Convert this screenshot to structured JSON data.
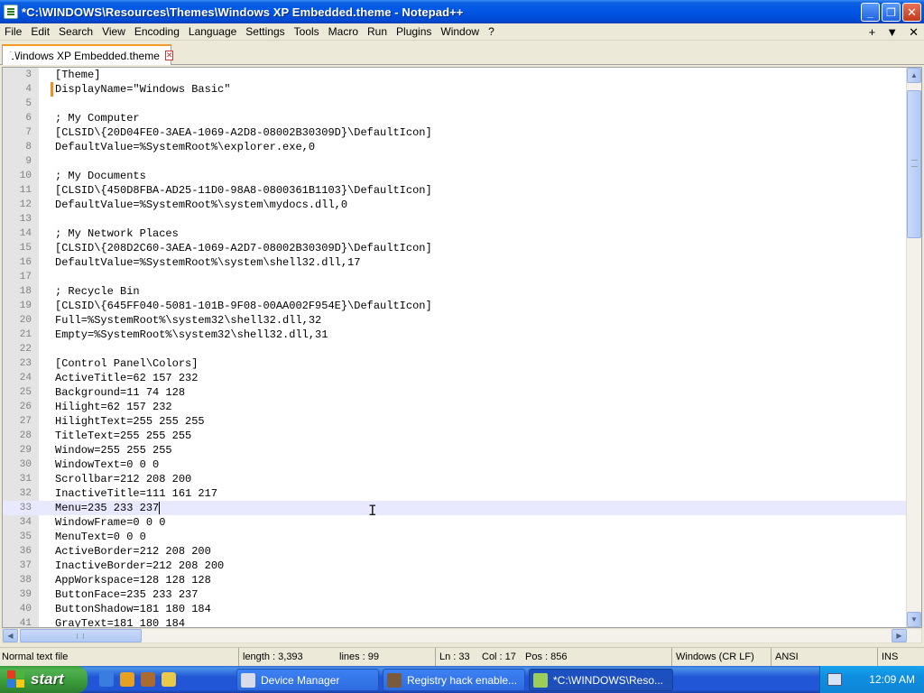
{
  "window": {
    "title": "*C:\\WINDOWS\\Resources\\Themes\\Windows XP Embedded.theme - Notepad++",
    "minimize_glyph": "_",
    "maximize_glyph": "❐",
    "close_glyph": "✕"
  },
  "menu": {
    "items": [
      "File",
      "Edit",
      "Search",
      "View",
      "Encoding",
      "Language",
      "Settings",
      "Tools",
      "Macro",
      "Run",
      "Plugins",
      "Window",
      "?"
    ],
    "right_glyphs": [
      "+",
      "▼",
      "✕"
    ]
  },
  "tab": {
    "label": "Windows XP Embedded.theme",
    "close_glyph": "✕"
  },
  "editor": {
    "current_line": 33,
    "lines": [
      {
        "n": "3",
        "t": "[Theme]"
      },
      {
        "n": "4",
        "t": "DisplayName=\"Windows Basic\""
      },
      {
        "n": "5",
        "t": ""
      },
      {
        "n": "6",
        "t": "; My Computer"
      },
      {
        "n": "7",
        "t": "[CLSID\\{20D04FE0-3AEA-1069-A2D8-08002B30309D}\\DefaultIcon]"
      },
      {
        "n": "8",
        "t": "DefaultValue=%SystemRoot%\\explorer.exe,0"
      },
      {
        "n": "9",
        "t": ""
      },
      {
        "n": "10",
        "t": "; My Documents"
      },
      {
        "n": "11",
        "t": "[CLSID\\{450D8FBA-AD25-11D0-98A8-0800361B1103}\\DefaultIcon]"
      },
      {
        "n": "12",
        "t": "DefaultValue=%SystemRoot%\\system\\mydocs.dll,0"
      },
      {
        "n": "13",
        "t": ""
      },
      {
        "n": "14",
        "t": "; My Network Places"
      },
      {
        "n": "15",
        "t": "[CLSID\\{208D2C60-3AEA-1069-A2D7-08002B30309D}\\DefaultIcon]"
      },
      {
        "n": "16",
        "t": "DefaultValue=%SystemRoot%\\system\\shell32.dll,17"
      },
      {
        "n": "17",
        "t": ""
      },
      {
        "n": "18",
        "t": "; Recycle Bin"
      },
      {
        "n": "19",
        "t": "[CLSID\\{645FF040-5081-101B-9F08-00AA002F954E}\\DefaultIcon]"
      },
      {
        "n": "20",
        "t": "Full=%SystemRoot%\\system32\\shell32.dll,32"
      },
      {
        "n": "21",
        "t": "Empty=%SystemRoot%\\system32\\shell32.dll,31"
      },
      {
        "n": "22",
        "t": ""
      },
      {
        "n": "23",
        "t": "[Control Panel\\Colors]"
      },
      {
        "n": "24",
        "t": "ActiveTitle=62 157 232"
      },
      {
        "n": "25",
        "t": "Background=11 74 128"
      },
      {
        "n": "26",
        "t": "Hilight=62 157 232"
      },
      {
        "n": "27",
        "t": "HilightText=255 255 255"
      },
      {
        "n": "28",
        "t": "TitleText=255 255 255"
      },
      {
        "n": "29",
        "t": "Window=255 255 255"
      },
      {
        "n": "30",
        "t": "WindowText=0 0 0"
      },
      {
        "n": "31",
        "t": "Scrollbar=212 208 200"
      },
      {
        "n": "32",
        "t": "InactiveTitle=111 161 217"
      },
      {
        "n": "33",
        "t": "Menu=235 233 237"
      },
      {
        "n": "34",
        "t": "WindowFrame=0 0 0"
      },
      {
        "n": "35",
        "t": "MenuText=0 0 0"
      },
      {
        "n": "36",
        "t": "ActiveBorder=212 208 200"
      },
      {
        "n": "37",
        "t": "InactiveBorder=212 208 200"
      },
      {
        "n": "38",
        "t": "AppWorkspace=128 128 128"
      },
      {
        "n": "39",
        "t": "ButtonFace=235 233 237"
      },
      {
        "n": "40",
        "t": "ButtonShadow=181 180 184"
      },
      {
        "n": "41",
        "t": "GrayText=181 180 184"
      }
    ]
  },
  "status": {
    "filetype": "Normal text file",
    "length": "length : 3,393",
    "lines": "lines : 99",
    "ln": "Ln : 33",
    "col": "Col : 17",
    "pos": "Pos : 856",
    "eol": "Windows (CR LF)",
    "encoding": "ANSI",
    "mode": "INS"
  },
  "taskbar": {
    "start_label": "start",
    "tasks": [
      {
        "label": "Device Manager",
        "icon_color": "#d8dce8"
      },
      {
        "label": "Registry hack enable...",
        "icon_color": "#7a5a3a"
      },
      {
        "label": "*C:\\WINDOWS\\Reso...",
        "icon_color": "#9ccf5a"
      }
    ],
    "quick_launch_colors": [
      "#3a7de0",
      "#e8a020",
      "#aa6a30",
      "#e9c84a"
    ],
    "clock": "12:09 AM"
  },
  "colors": {
    "titlebar_blue": "#0055e5",
    "taskbar_blue": "#2157d7",
    "start_green": "#3a9a3a",
    "current_line": "#e8e8ff",
    "tab_accent": "#f59a23"
  }
}
